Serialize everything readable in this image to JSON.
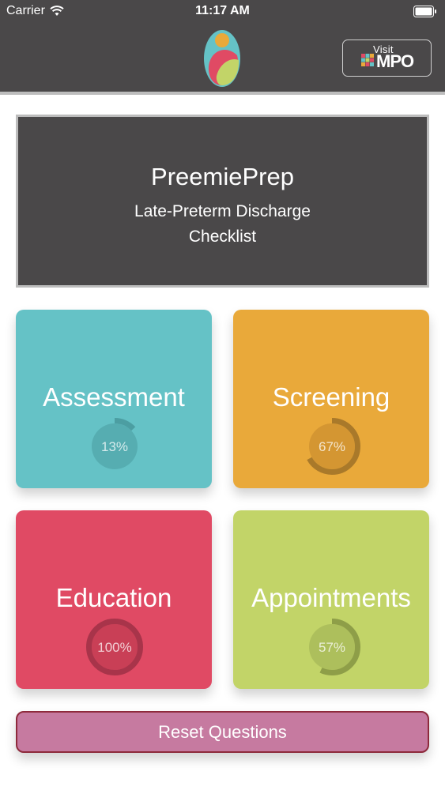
{
  "status_bar": {
    "carrier": "Carrier",
    "time": "11:17 AM",
    "wifi_icon": "wifi-icon",
    "battery_icon": "battery-icon"
  },
  "nav": {
    "logo_icon": "preemieprep-logo",
    "visit_button": {
      "line1": "Visit",
      "line2": "MPO"
    }
  },
  "banner": {
    "title": "PreemiePrep",
    "subtitle_line1": "Late-Preterm Discharge",
    "subtitle_line2": "Checklist"
  },
  "tiles": [
    {
      "label": "Assessment",
      "percent_text": "13%",
      "progress": 0.13,
      "color": "#65c2c6",
      "ring_fill": "#56adb1",
      "ring_track": "#4c9ea2"
    },
    {
      "label": "Screening",
      "percent_text": "67%",
      "progress": 0.67,
      "color": "#e9a93a",
      "ring_fill": "#d49632",
      "ring_track": "#a9792a"
    },
    {
      "label": "Education",
      "percent_text": "100%",
      "progress": 1.0,
      "color": "#e04a64",
      "ring_fill": "#c93f56",
      "ring_track": "#a8344a"
    },
    {
      "label": "Appointments",
      "percent_text": "57%",
      "progress": 0.57,
      "color": "#c2d468",
      "ring_fill": "#adbf5c",
      "ring_track": "#8e9e48"
    }
  ],
  "reset_button": {
    "label": "Reset Questions"
  }
}
